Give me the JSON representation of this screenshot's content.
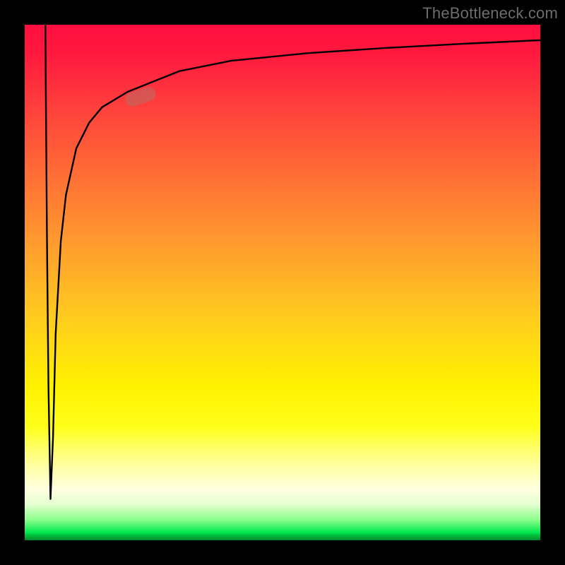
{
  "watermark": {
    "text": "TheBottleneck.com"
  },
  "marker": {
    "x_pct": 22.5,
    "y_pct": 86,
    "label": "highlighted-point"
  },
  "chart_data": {
    "type": "line",
    "title": "",
    "xlabel": "",
    "ylabel": "",
    "xlim": [
      0,
      100
    ],
    "ylim": [
      0,
      100
    ],
    "grid": false,
    "legend": false,
    "background_gradient": {
      "direction": "vertical",
      "stops": [
        {
          "pos": 0.0,
          "color": "#ff0e3f"
        },
        {
          "pos": 0.5,
          "color": "#ffc400"
        },
        {
          "pos": 0.85,
          "color": "#ffffc0"
        },
        {
          "pos": 0.98,
          "color": "#00e84d"
        },
        {
          "pos": 1.0,
          "color": "#008a2c"
        }
      ]
    },
    "series": [
      {
        "name": "bottleneck-curve",
        "x": [
          4.0,
          4.3,
          4.6,
          5.0,
          5.5,
          6.0,
          7.0,
          8.0,
          10.0,
          12.5,
          15.0,
          20.0,
          25.0,
          30.0,
          40.0,
          55.0,
          70.0,
          85.0,
          100.0
        ],
        "y": [
          100,
          60,
          30,
          8,
          20,
          40,
          58,
          67,
          76,
          81,
          84,
          87,
          89,
          91,
          93,
          94.5,
          95.5,
          96.3,
          97
        ]
      }
    ],
    "highlight": {
      "series": "bottleneck-curve",
      "x": 22.5,
      "y": 86
    }
  }
}
